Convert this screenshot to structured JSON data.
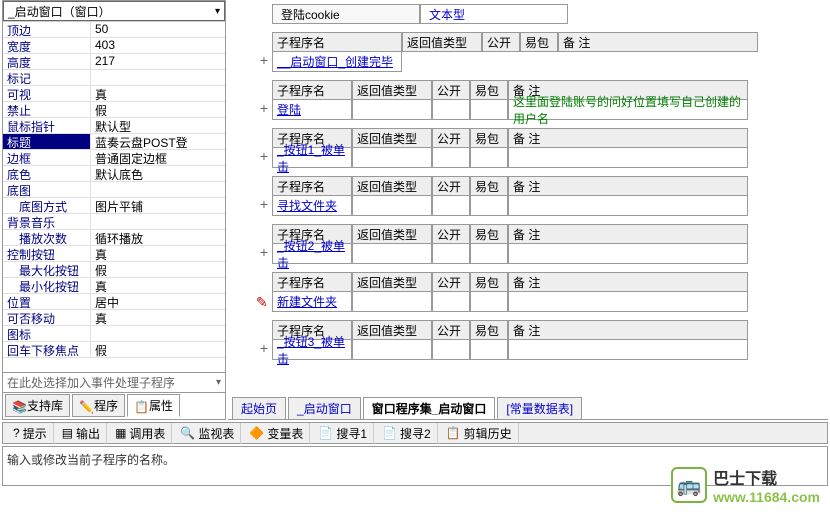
{
  "dropdown": "_启动窗口（窗口）",
  "properties": [
    {
      "key": "顶边",
      "val": "50"
    },
    {
      "key": "宽度",
      "val": "403"
    },
    {
      "key": "高度",
      "val": "217"
    },
    {
      "key": "标记",
      "val": ""
    },
    {
      "key": "可视",
      "val": "真"
    },
    {
      "key": "禁止",
      "val": "假"
    },
    {
      "key": "鼠标指针",
      "val": "默认型"
    },
    {
      "key": "标题",
      "val": "蓝奏云盘POST登",
      "sel": true
    },
    {
      "key": "边框",
      "val": "普通固定边框"
    },
    {
      "key": "底色",
      "val": "默认底色"
    },
    {
      "key": "底图",
      "val": ""
    },
    {
      "key": "底图方式",
      "val": "图片平铺",
      "indent": true
    },
    {
      "key": "背景音乐",
      "val": ""
    },
    {
      "key": "播放次数",
      "val": "循环播放",
      "indent": true
    },
    {
      "key": "控制按钮",
      "val": "真"
    },
    {
      "key": "最大化按钮",
      "val": "假",
      "indent": true
    },
    {
      "key": "最小化按钮",
      "val": "真",
      "indent": true
    },
    {
      "key": "位置",
      "val": "居中"
    },
    {
      "key": "可否移动",
      "val": "真"
    },
    {
      "key": "图标",
      "val": ""
    },
    {
      "key": "回车下移焦点",
      "val": "假"
    }
  ],
  "event_placeholder": "在此处选择加入事件处理子程序",
  "left_tabs": {
    "support": "支持库",
    "program": "程序",
    "property": "属性"
  },
  "var": {
    "name": "登陆cookie",
    "type": "文本型"
  },
  "cols": {
    "name": "子程序名",
    "ret": "返回值类型",
    "pub": "公开",
    "easy": "易包",
    "note": "备 注"
  },
  "procs": [
    {
      "name": "__启动窗口_创建完毕",
      "note": ""
    },
    {
      "name": "登陆",
      "note": "这里面登陆账号的问好位置填写自己创建的用户名"
    },
    {
      "name": "_按钮1_被单击",
      "note": ""
    },
    {
      "name": "寻找文件夹",
      "note": ""
    },
    {
      "name": "_按钮2_被单击",
      "note": ""
    },
    {
      "name": "新建文件夹",
      "note": "",
      "editing": true
    },
    {
      "name": "_按钮3_被单击",
      "note": ""
    }
  ],
  "editor_tabs": {
    "start": "起始页",
    "startup": "_启动窗口",
    "procset": "窗口程序集_启动窗口",
    "const": "[常量数据表]"
  },
  "bottom_tabs": {
    "hint": "提示",
    "output": "输出",
    "calls": "调用表",
    "watch": "监视表",
    "vars": "变量表",
    "find1": "搜寻1",
    "find2": "搜寻2",
    "clip": "剪辑历史"
  },
  "status_text": "输入或修改当前子程序的名称。",
  "wm": {
    "brand": "巴士下载",
    "domain": "www.11684.com"
  }
}
